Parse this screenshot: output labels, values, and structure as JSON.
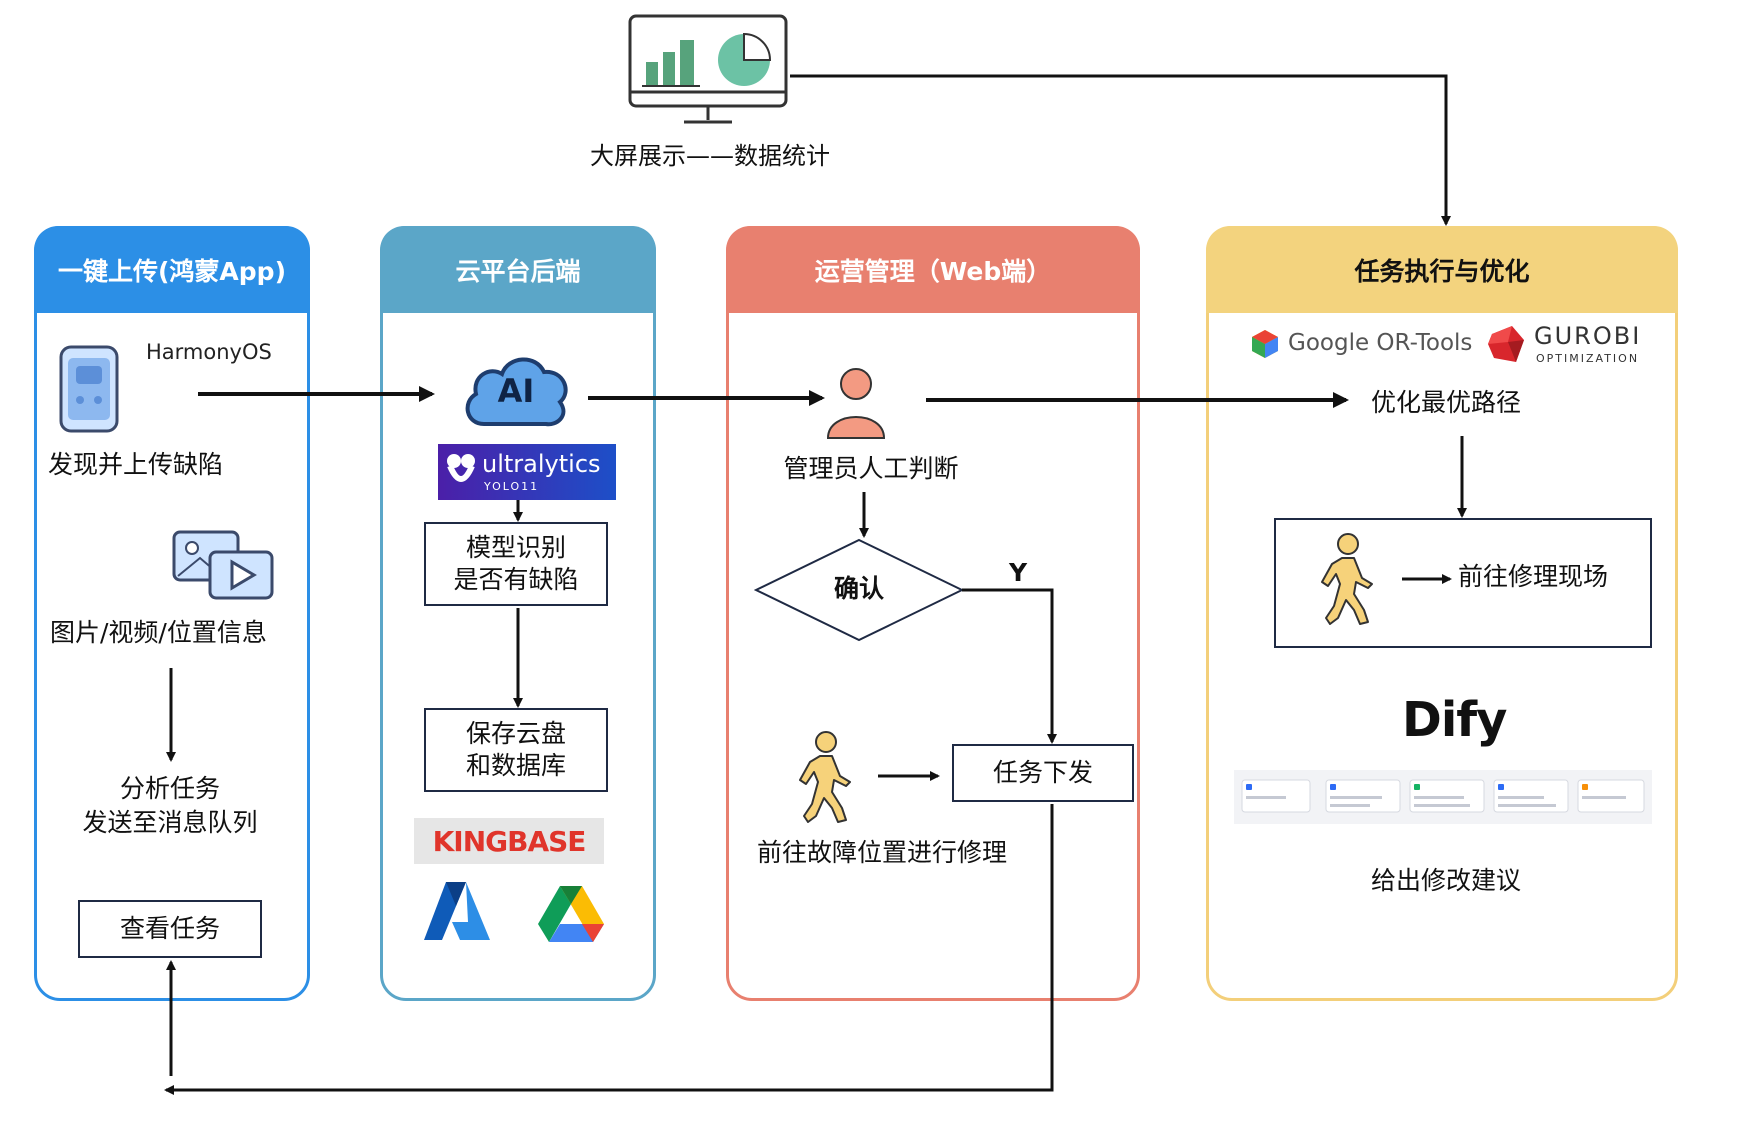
{
  "monitor_caption": "大屏展示——数据统计",
  "lanes": [
    {
      "title": "一键上传(鸿蒙App)",
      "color": "#2c8fe6",
      "head_color": "#2c8fe6"
    },
    {
      "title": "云平台后端",
      "color": "#5ba6c8",
      "head_color": "#5ba6c8"
    },
    {
      "title": "运营管理（Web端）",
      "color": "#e8806f",
      "head_color": "#e8806f"
    },
    {
      "title": "任务执行与优化",
      "color": "#f3cf7a",
      "head_color": "#f3d37e"
    }
  ],
  "lane1": {
    "harmony_logo": "HarmonyOS",
    "discover": "发现并上传缺陷",
    "media_info": "图片/视频/位置信息",
    "analyze_line1": "分析任务",
    "analyze_line2": "发送至消息队列",
    "view_task": "查看任务"
  },
  "lane2": {
    "ai_label": "AI",
    "ultralytics_name": "ultralytics",
    "ultralytics_sub": "YOLO11",
    "model_line1": "模型识别",
    "model_line2": "是否有缺陷",
    "save_line1": "保存云盘",
    "save_line2": "和数据库",
    "kingbase": "KINGBASE"
  },
  "lane3": {
    "admin_judge": "管理员人工判断",
    "confirm": "确认",
    "yes_label": "Y",
    "dispatch": "任务下发",
    "go_repair": "前往故障位置进行修理"
  },
  "lane4": {
    "google_ortools": "Google OR-Tools",
    "gurobi": "GUROBI",
    "gurobi_sub": "OPTIMIZATION",
    "optimize_route": "优化最优路径",
    "go_site": "前往修理现场",
    "dify": "Dify",
    "suggest": "给出修改建议"
  }
}
